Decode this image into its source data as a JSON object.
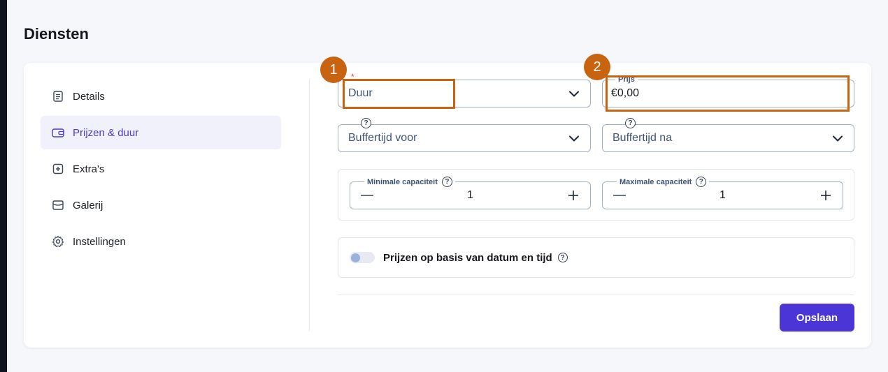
{
  "page": {
    "title": "Diensten"
  },
  "sidebar": {
    "items": [
      {
        "label": "Details",
        "icon": "document-icon"
      },
      {
        "label": "Prijzen & duur",
        "icon": "wallet-icon",
        "active": true
      },
      {
        "label": "Extra's",
        "icon": "plus-square-icon"
      },
      {
        "label": "Galerij",
        "icon": "gallery-icon"
      },
      {
        "label": "Instellingen",
        "icon": "gear-icon"
      }
    ]
  },
  "form": {
    "duration": {
      "placeholder": "Duur",
      "required_mark": "*"
    },
    "price": {
      "label": "Prijs",
      "value": "€0,00"
    },
    "buffer_before": {
      "placeholder": "Buffertijd voor",
      "help": "?"
    },
    "buffer_after": {
      "placeholder": "Buffertijd na",
      "help": "?"
    },
    "min_capacity": {
      "label": "Minimale capaciteit",
      "value": "1",
      "help": "?"
    },
    "max_capacity": {
      "label": "Maximale capaciteit",
      "value": "1",
      "help": "?"
    },
    "date_time_pricing": {
      "label": "Prijzen op basis van datum en tijd",
      "enabled": false,
      "help": "?"
    },
    "save_label": "Opslaan"
  },
  "annotations": [
    {
      "number": "1"
    },
    {
      "number": "2"
    }
  ],
  "colors": {
    "accent": "#4b35d6",
    "annotation": "#c8630f",
    "active_bg": "#f1f1fb",
    "field_border": "#9fb1c7"
  }
}
